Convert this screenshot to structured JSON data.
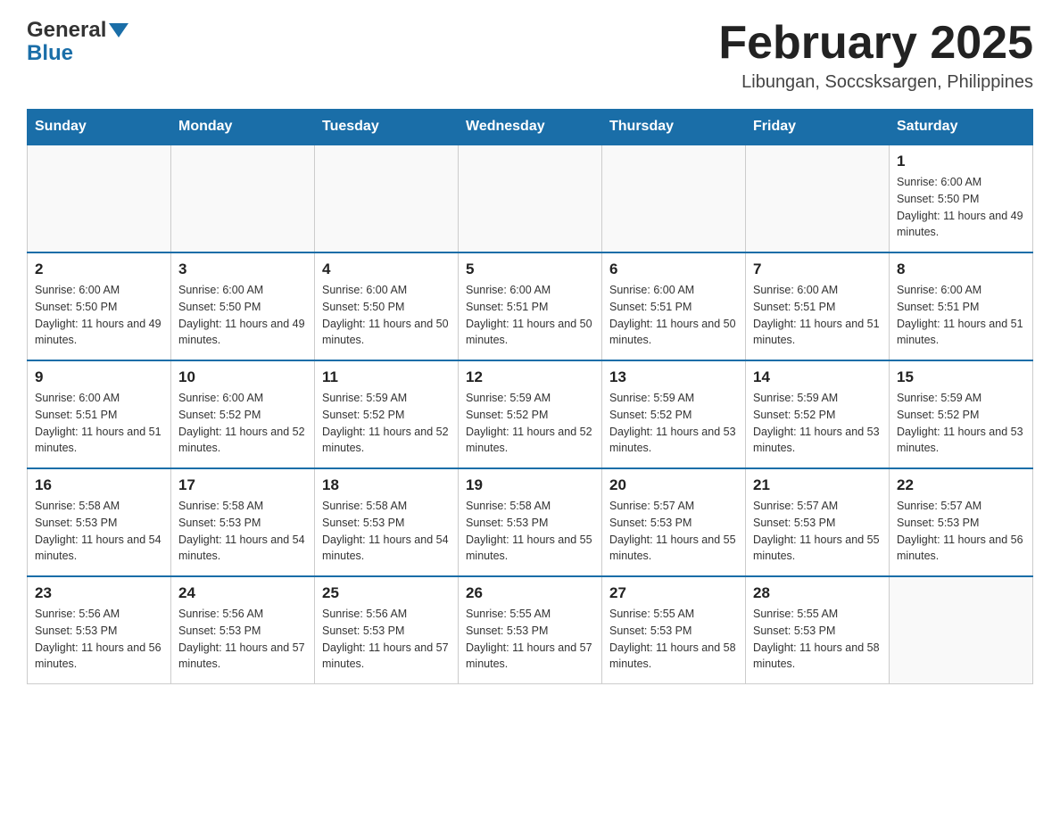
{
  "header": {
    "logo_general": "General",
    "logo_blue": "Blue",
    "title": "February 2025",
    "subtitle": "Libungan, Soccsksargen, Philippines"
  },
  "days_of_week": [
    "Sunday",
    "Monday",
    "Tuesday",
    "Wednesday",
    "Thursday",
    "Friday",
    "Saturday"
  ],
  "weeks": [
    [
      {
        "day": "",
        "info": ""
      },
      {
        "day": "",
        "info": ""
      },
      {
        "day": "",
        "info": ""
      },
      {
        "day": "",
        "info": ""
      },
      {
        "day": "",
        "info": ""
      },
      {
        "day": "",
        "info": ""
      },
      {
        "day": "1",
        "info": "Sunrise: 6:00 AM\nSunset: 5:50 PM\nDaylight: 11 hours and 49 minutes."
      }
    ],
    [
      {
        "day": "2",
        "info": "Sunrise: 6:00 AM\nSunset: 5:50 PM\nDaylight: 11 hours and 49 minutes."
      },
      {
        "day": "3",
        "info": "Sunrise: 6:00 AM\nSunset: 5:50 PM\nDaylight: 11 hours and 49 minutes."
      },
      {
        "day": "4",
        "info": "Sunrise: 6:00 AM\nSunset: 5:50 PM\nDaylight: 11 hours and 50 minutes."
      },
      {
        "day": "5",
        "info": "Sunrise: 6:00 AM\nSunset: 5:51 PM\nDaylight: 11 hours and 50 minutes."
      },
      {
        "day": "6",
        "info": "Sunrise: 6:00 AM\nSunset: 5:51 PM\nDaylight: 11 hours and 50 minutes."
      },
      {
        "day": "7",
        "info": "Sunrise: 6:00 AM\nSunset: 5:51 PM\nDaylight: 11 hours and 51 minutes."
      },
      {
        "day": "8",
        "info": "Sunrise: 6:00 AM\nSunset: 5:51 PM\nDaylight: 11 hours and 51 minutes."
      }
    ],
    [
      {
        "day": "9",
        "info": "Sunrise: 6:00 AM\nSunset: 5:51 PM\nDaylight: 11 hours and 51 minutes."
      },
      {
        "day": "10",
        "info": "Sunrise: 6:00 AM\nSunset: 5:52 PM\nDaylight: 11 hours and 52 minutes."
      },
      {
        "day": "11",
        "info": "Sunrise: 5:59 AM\nSunset: 5:52 PM\nDaylight: 11 hours and 52 minutes."
      },
      {
        "day": "12",
        "info": "Sunrise: 5:59 AM\nSunset: 5:52 PM\nDaylight: 11 hours and 52 minutes."
      },
      {
        "day": "13",
        "info": "Sunrise: 5:59 AM\nSunset: 5:52 PM\nDaylight: 11 hours and 53 minutes."
      },
      {
        "day": "14",
        "info": "Sunrise: 5:59 AM\nSunset: 5:52 PM\nDaylight: 11 hours and 53 minutes."
      },
      {
        "day": "15",
        "info": "Sunrise: 5:59 AM\nSunset: 5:52 PM\nDaylight: 11 hours and 53 minutes."
      }
    ],
    [
      {
        "day": "16",
        "info": "Sunrise: 5:58 AM\nSunset: 5:53 PM\nDaylight: 11 hours and 54 minutes."
      },
      {
        "day": "17",
        "info": "Sunrise: 5:58 AM\nSunset: 5:53 PM\nDaylight: 11 hours and 54 minutes."
      },
      {
        "day": "18",
        "info": "Sunrise: 5:58 AM\nSunset: 5:53 PM\nDaylight: 11 hours and 54 minutes."
      },
      {
        "day": "19",
        "info": "Sunrise: 5:58 AM\nSunset: 5:53 PM\nDaylight: 11 hours and 55 minutes."
      },
      {
        "day": "20",
        "info": "Sunrise: 5:57 AM\nSunset: 5:53 PM\nDaylight: 11 hours and 55 minutes."
      },
      {
        "day": "21",
        "info": "Sunrise: 5:57 AM\nSunset: 5:53 PM\nDaylight: 11 hours and 55 minutes."
      },
      {
        "day": "22",
        "info": "Sunrise: 5:57 AM\nSunset: 5:53 PM\nDaylight: 11 hours and 56 minutes."
      }
    ],
    [
      {
        "day": "23",
        "info": "Sunrise: 5:56 AM\nSunset: 5:53 PM\nDaylight: 11 hours and 56 minutes."
      },
      {
        "day": "24",
        "info": "Sunrise: 5:56 AM\nSunset: 5:53 PM\nDaylight: 11 hours and 57 minutes."
      },
      {
        "day": "25",
        "info": "Sunrise: 5:56 AM\nSunset: 5:53 PM\nDaylight: 11 hours and 57 minutes."
      },
      {
        "day": "26",
        "info": "Sunrise: 5:55 AM\nSunset: 5:53 PM\nDaylight: 11 hours and 57 minutes."
      },
      {
        "day": "27",
        "info": "Sunrise: 5:55 AM\nSunset: 5:53 PM\nDaylight: 11 hours and 58 minutes."
      },
      {
        "day": "28",
        "info": "Sunrise: 5:55 AM\nSunset: 5:53 PM\nDaylight: 11 hours and 58 minutes."
      },
      {
        "day": "",
        "info": ""
      }
    ]
  ]
}
